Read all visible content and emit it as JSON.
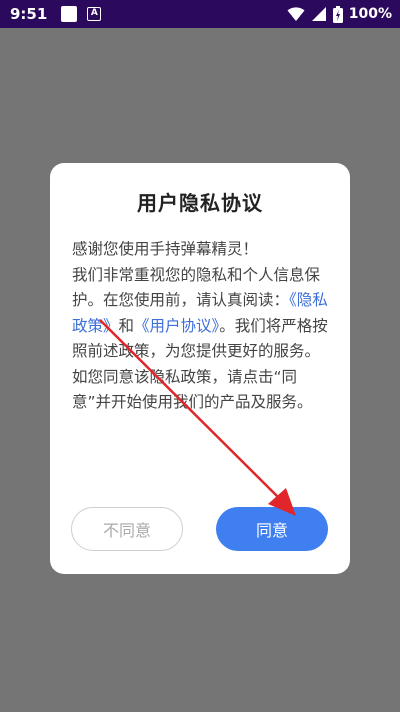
{
  "status_bar": {
    "time": "9:51",
    "app_icon": "A",
    "battery": "100%",
    "icons": [
      "wifi-icon",
      "signal-icon",
      "battery-icon"
    ]
  },
  "dialog": {
    "title": "用户隐私协议",
    "greeting": "感谢您使用手持弹幕精灵！",
    "body_1": "我们非常重视您的隐私和个人信息保护。在您使用前，请认真阅读：",
    "privacy_link": "《隐私政策》",
    "conjunction": "和",
    "user_link": "《用户协议》",
    "body_2": "。我们将严格按照前述政策，为您提供更好的服务。如您同意该隐私政策，请点击“同意”并开始使用我们的产品及服务。",
    "disagree_label": "不同意",
    "agree_label": "同意"
  },
  "colors": {
    "status_bar": "#2b0a5e",
    "scrim": "#757575",
    "link": "#3c6fd8",
    "agree_button": "#3f7ff0",
    "annotation_arrow": "#e0262a"
  }
}
